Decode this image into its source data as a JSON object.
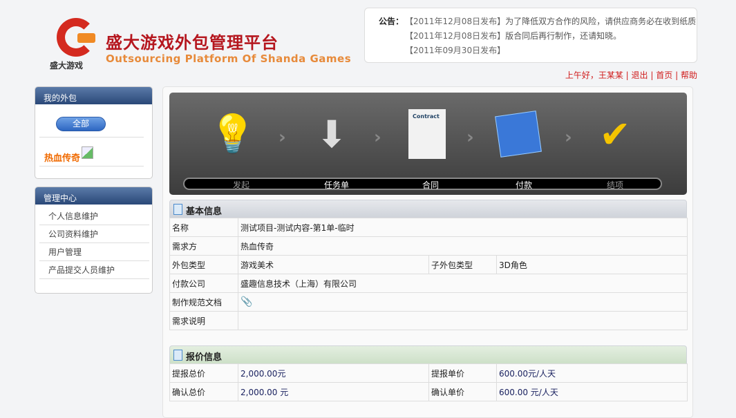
{
  "header": {
    "logo_text": "盛大游戏",
    "title_cn": "盛大游戏外包管理平台",
    "title_en": "Outsourcing Platform Of Shanda Games"
  },
  "notice": {
    "label": "公告：",
    "items": [
      {
        "date": "【2011年12月08日发布】",
        "text": "为了降低双方合作的风险，请供应商务必在收到纸质"
      },
      {
        "date": "【2011年12月08日发布】",
        "text": "版合同后再行制作，还请知晓。"
      },
      {
        "date": "【2011年09月30日发布】",
        "text": ""
      }
    ]
  },
  "greeting": {
    "hello": "上午好，王某某",
    "logout": "退出",
    "home": "首页",
    "help": "帮助",
    "sep": "|"
  },
  "sidebar": {
    "my_title": "我的外包",
    "all_button": "全部",
    "game": "热血传奇",
    "mgmt_title": "管理中心",
    "items": [
      "个人信息维护",
      "公司资料维护",
      "用户管理",
      "产品提交人员维护"
    ]
  },
  "steps": [
    {
      "label": "发起",
      "icon": "lightbulb-icon"
    },
    {
      "label": "任务单",
      "icon": "arrow-down-icon"
    },
    {
      "label": "合同",
      "icon": "contract-icon"
    },
    {
      "label": "付款",
      "icon": "xcode-hammer-icon"
    },
    {
      "label": "结项",
      "icon": "checklist-icon"
    }
  ],
  "basic": {
    "title": "基本信息",
    "name_l": "名称",
    "name_v": "测试项目-测试内容-第1单-临时",
    "req_l": "需求方",
    "req_v": "热血传奇",
    "type_l": "外包类型",
    "type_v": "游戏美术",
    "sub_l": "子外包类型",
    "sub_v": "3D角色",
    "pay_l": "付款公司",
    "pay_v": "盛趣信息技术（上海）有限公司",
    "doc_l": "制作规范文档",
    "desc_l": "需求说明"
  },
  "quote": {
    "title": "报价信息",
    "t1_l": "提报总价",
    "t1_v": "2,000.00元",
    "u1_l": "提报单价",
    "u1_v": "600.00元/人天",
    "t2_l": "确认总价",
    "t2_v": "2,000.00 元",
    "u2_l": "确认单价",
    "u2_v": "600.00 元/人天"
  }
}
